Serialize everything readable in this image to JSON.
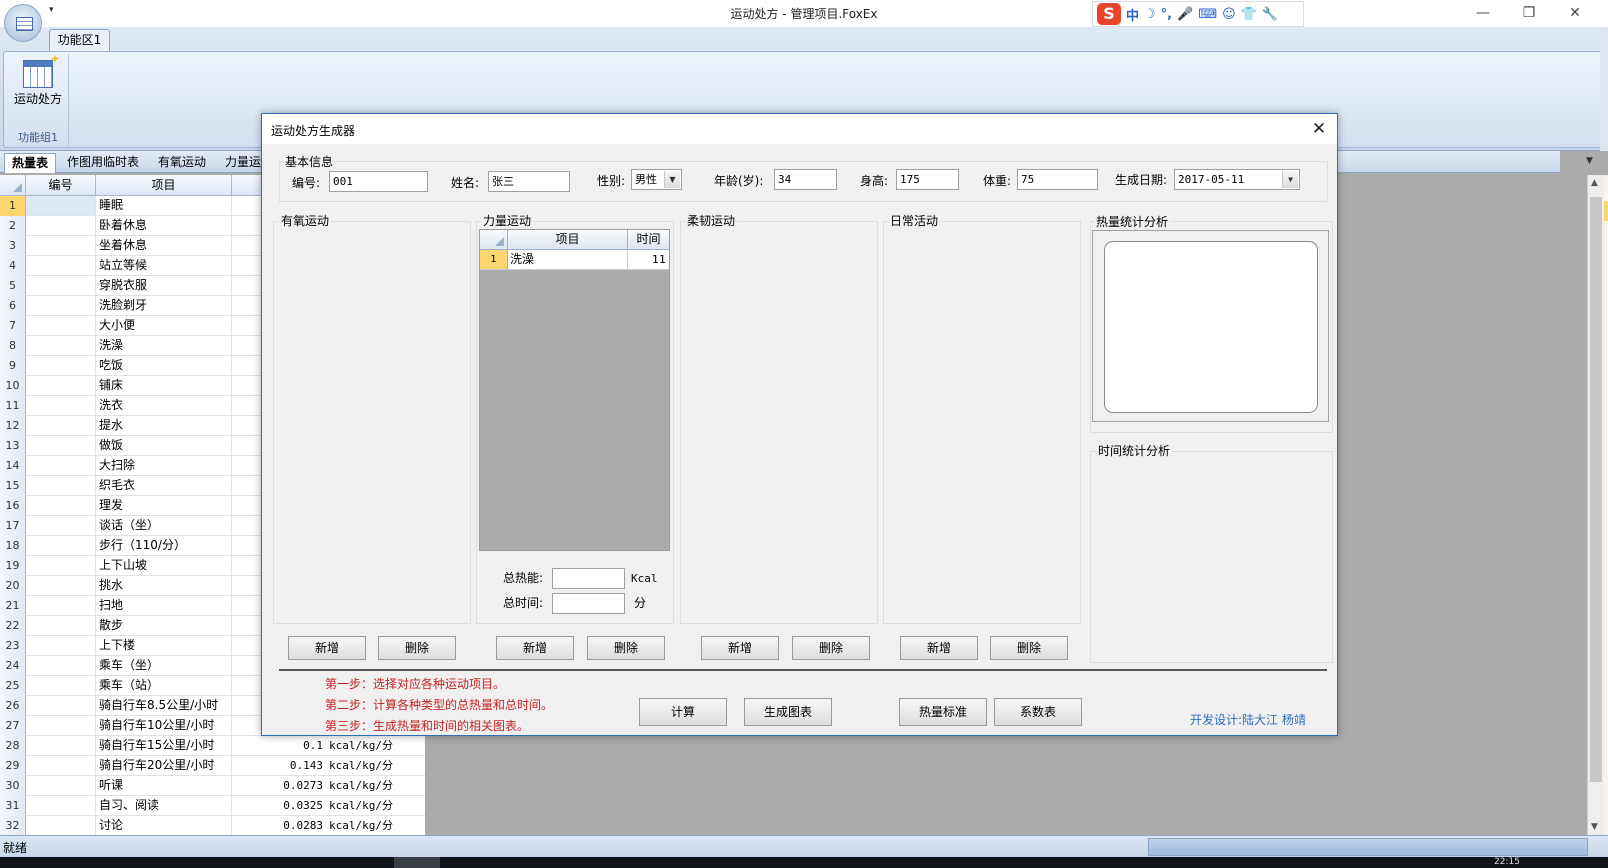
{
  "window": {
    "title": "运动处方 - 管理项目.FoxEx",
    "minimize": "—",
    "restore": "❐",
    "close": "✕",
    "qat_arrow": "▾"
  },
  "ime": {
    "logo": "S",
    "items": [
      "中",
      "☽",
      "°,",
      "🎤",
      "⌨",
      "☺",
      "👕",
      "🔧"
    ]
  },
  "ribbon": {
    "tab": "功能区1",
    "button_label": "运动处方",
    "group_label": "功能组1"
  },
  "sheet_tabs": [
    "热量表",
    "作图用临时表",
    "有氧运动",
    "力量运"
  ],
  "grid": {
    "headers": [
      "编号",
      "项目"
    ],
    "rows": [
      {
        "n": "1",
        "item": "睡眠",
        "value": "",
        "unit": ""
      },
      {
        "n": "2",
        "item": "卧着休息",
        "value": "",
        "unit": ""
      },
      {
        "n": "3",
        "item": "坐着休息",
        "value": "",
        "unit": ""
      },
      {
        "n": "4",
        "item": "站立等候",
        "value": "",
        "unit": ""
      },
      {
        "n": "5",
        "item": "穿脱衣服",
        "value": "",
        "unit": ""
      },
      {
        "n": "6",
        "item": "洗脸剃牙",
        "value": "",
        "unit": ""
      },
      {
        "n": "7",
        "item": "大小便",
        "value": "",
        "unit": ""
      },
      {
        "n": "8",
        "item": "洗澡",
        "value": "",
        "unit": ""
      },
      {
        "n": "9",
        "item": "吃饭",
        "value": "",
        "unit": ""
      },
      {
        "n": "10",
        "item": "铺床",
        "value": "",
        "unit": ""
      },
      {
        "n": "11",
        "item": "洗衣",
        "value": "",
        "unit": ""
      },
      {
        "n": "12",
        "item": "提水",
        "value": "",
        "unit": ""
      },
      {
        "n": "13",
        "item": "做饭",
        "value": "",
        "unit": ""
      },
      {
        "n": "14",
        "item": "大扫除",
        "value": "",
        "unit": ""
      },
      {
        "n": "15",
        "item": "织毛衣",
        "value": "",
        "unit": ""
      },
      {
        "n": "16",
        "item": "理发",
        "value": "",
        "unit": ""
      },
      {
        "n": "17",
        "item": "谈话（坐）",
        "value": "",
        "unit": ""
      },
      {
        "n": "18",
        "item": "步行（110/分）",
        "value": "",
        "unit": ""
      },
      {
        "n": "19",
        "item": "上下山坡",
        "value": "",
        "unit": ""
      },
      {
        "n": "20",
        "item": "挑水",
        "value": "",
        "unit": ""
      },
      {
        "n": "21",
        "item": "扫地",
        "value": "",
        "unit": ""
      },
      {
        "n": "22",
        "item": "散步",
        "value": "",
        "unit": ""
      },
      {
        "n": "23",
        "item": "上下楼",
        "value": "",
        "unit": ""
      },
      {
        "n": "24",
        "item": "乘车（坐）",
        "value": "",
        "unit": ""
      },
      {
        "n": "25",
        "item": "乘车（站）",
        "value": "",
        "unit": ""
      },
      {
        "n": "26",
        "item": "骑自行车8.5公里/小时",
        "value": "",
        "unit": ""
      },
      {
        "n": "27",
        "item": "骑自行车10公里/小时",
        "value": "",
        "unit": ""
      },
      {
        "n": "28",
        "item": "骑自行车15公里/小时",
        "value": "0.1",
        "unit": "kcal/kg/分"
      },
      {
        "n": "29",
        "item": "骑自行车20公里/小时",
        "value": "0.143",
        "unit": "kcal/kg/分"
      },
      {
        "n": "30",
        "item": "听课",
        "value": "0.0273",
        "unit": "kcal/kg/分"
      },
      {
        "n": "31",
        "item": "自习、阅读",
        "value": "0.0325",
        "unit": "kcal/kg/分"
      },
      {
        "n": "32",
        "item": "讨论",
        "value": "0.0283",
        "unit": "kcal/kg/分"
      }
    ]
  },
  "status": {
    "text": "就绪",
    "clock": "22:15"
  },
  "dialog": {
    "title": "运动处方生成器",
    "close": "✕",
    "basic_info": {
      "legend": "基本信息",
      "id_label": "编号:",
      "id_value": "001",
      "name_label": "姓名:",
      "name_value": "张三",
      "gender_label": "性别:",
      "gender_value": "男性",
      "age_label": "年龄(岁):",
      "age_value": "34",
      "height_label": "身高:",
      "height_value": "175",
      "weight_label": "体重:",
      "weight_value": "75",
      "date_label": "生成日期:",
      "date_value": "2017-05-11"
    },
    "sections": {
      "aerobic": "有氧运动",
      "strength": "力量运动",
      "flex": "柔韧运动",
      "daily": "日常活动",
      "calorie_analysis": "热量统计分析",
      "time_analysis": "时间统计分析"
    },
    "strength_grid": {
      "headers": [
        "项目",
        "时间"
      ],
      "row": {
        "n": "1",
        "item": "洗澡",
        "time": "11"
      }
    },
    "totals": {
      "energy_label": "总热能:",
      "energy_value": "",
      "energy_unit": "Kcal",
      "time_label": "总时间:",
      "time_value": "",
      "time_unit": "分"
    },
    "buttons": {
      "add": "新增",
      "delete": "删除",
      "calc": "计算",
      "chart": "生成图表",
      "calorie_std": "热量标准",
      "coef_table": "系数表"
    },
    "steps": [
      "第一步：选择对应各种运动项目。",
      "第二步：计算各种类型的总热量和总时间。",
      "第三步：生成热量和时间的相关图表。"
    ],
    "credit": "开发设计:陆大江 杨靖"
  }
}
